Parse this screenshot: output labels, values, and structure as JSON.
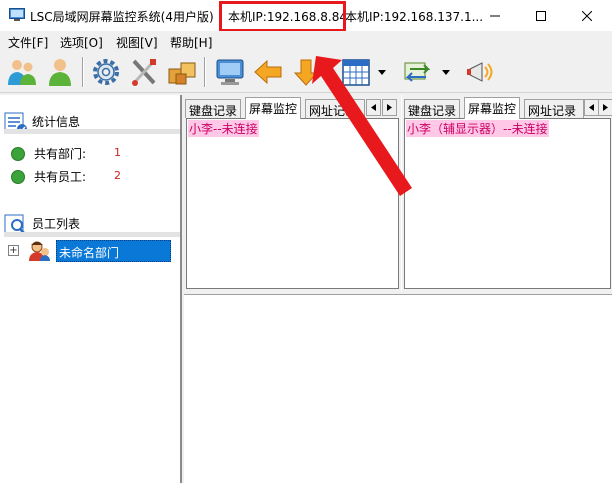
{
  "window": {
    "title": "LSC局域网屏幕监控系统(4用户版)",
    "ip_primary": "本机IP:192.168.8.84",
    "ip_secondary": "本机IP:192.168.137.1...",
    "highlight_color": "#e8191c"
  },
  "window_controls": {
    "minimize_icon": "minimize-icon",
    "maximize_icon": "maximize-icon",
    "close_icon": "close-icon"
  },
  "menu": [
    {
      "label": "文件[F]"
    },
    {
      "label": "选项[O]"
    },
    {
      "label": "视图[V]"
    },
    {
      "label": "帮助[H]"
    }
  ],
  "toolbar": {
    "icons": [
      "add-users-icon",
      "user-icon",
      "settings-gear-icon",
      "tools-icon",
      "boxes-icon",
      "monitor-icon",
      "arrow-left-icon",
      "arrow-down-icon",
      "calendar-grid-icon",
      "dropdown-arrow-icon",
      "transfer-icon",
      "dropdown-arrow-icon",
      "megaphone-icon"
    ]
  },
  "stats": {
    "title": "统计信息",
    "items": [
      {
        "label": "共有部门:",
        "value": "1"
      },
      {
        "label": "共有员工:",
        "value": "2"
      }
    ]
  },
  "employees": {
    "title": "员工列表",
    "tree_node": "未命名部门",
    "expand_symbol": "+"
  },
  "panes": [
    {
      "tabs": [
        "键盘记录",
        "屏幕监控",
        "网址记录"
      ],
      "active_tab": "屏幕监控",
      "entry": "小李--未连接"
    },
    {
      "tabs": [
        "键盘记录",
        "屏幕监控",
        "网址记录"
      ],
      "active_tab": "屏幕监控",
      "entry": "小李（辅显示器）--未连接"
    }
  ],
  "colors": {
    "selection": "#0a78d7",
    "entry_text": "#cc0066",
    "entry_bg": "#ffc8e6",
    "stat_value": "#d02020"
  }
}
